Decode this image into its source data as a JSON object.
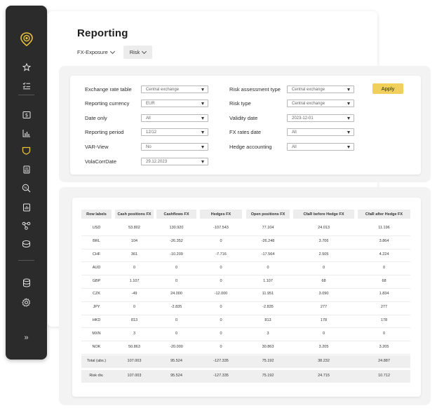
{
  "sidebar": {
    "logo_icon": "location-pin-icon",
    "items": [
      {
        "name": "star-icon"
      },
      {
        "name": "checklist-icon"
      },
      {
        "name": "dollar-document-icon"
      },
      {
        "name": "bar-chart-icon"
      },
      {
        "name": "shield-icon",
        "active": true
      },
      {
        "name": "document-icon"
      },
      {
        "name": "percent-search-icon"
      },
      {
        "name": "report-icon"
      },
      {
        "name": "flow-icon"
      },
      {
        "name": "coins-icon"
      },
      {
        "name": "database-icon"
      },
      {
        "name": "settings-icon"
      },
      {
        "name": "expand-icon",
        "label": "»"
      }
    ],
    "accent": "#e8c23a"
  },
  "page": {
    "title": "Reporting",
    "tabs": [
      {
        "label": "FX-Exposure"
      },
      {
        "label": "Risk",
        "active": true
      }
    ]
  },
  "filters": {
    "left": [
      {
        "label": "Exchange rate table",
        "value": "Central exchange"
      },
      {
        "label": "Reporting currency",
        "value": "EUR"
      },
      {
        "label": "Date only",
        "value": "All"
      },
      {
        "label": "Reporting period",
        "value": "12/12"
      },
      {
        "label": "VAR-View",
        "value": "No"
      },
      {
        "label": "VolaCorrDate",
        "value": "29.12.2023"
      }
    ],
    "right": [
      {
        "label": "Risk assessment type",
        "value": "Central exchange"
      },
      {
        "label": "Risk type",
        "value": "Central exchange"
      },
      {
        "label": "Validity date",
        "value": "2023-12-01"
      },
      {
        "label": "FX rates date",
        "value": "All"
      },
      {
        "label": "Hedge accounting",
        "value": "All"
      }
    ],
    "apply_label": "Apply",
    "apply_color": "#f0cf5a"
  },
  "table": {
    "headers": [
      "Row labels",
      "Cash positions FX",
      "Cashflows FX",
      "Hedges FX",
      "Open positions FX",
      "CfaR before Hedge FX",
      "CfaR after Hedge FX"
    ],
    "rows": [
      [
        "USD",
        "53.802",
        "130.920",
        "-107.543",
        "77.104",
        "24.013",
        "11.196"
      ],
      [
        "BRL",
        "104",
        "-26.352",
        "0",
        "-26.248",
        "3.706",
        "3.864"
      ],
      [
        "CHF",
        "361",
        "-10.209",
        "-7.716",
        "-17.564",
        "2.505",
        "4.224"
      ],
      [
        "AUD",
        "0",
        "0",
        "0",
        "0",
        "0",
        "0"
      ],
      [
        "GBP",
        "1.107",
        "0",
        "0",
        "1.107",
        "68",
        "68"
      ],
      [
        "CZK",
        "-49",
        "24.000",
        "-12.000",
        "11.951",
        "3.090",
        "1.834"
      ],
      [
        "JPY",
        "0",
        "-2.835",
        "0",
        "-2.835",
        "277",
        "277"
      ],
      [
        "HKD",
        "813",
        "0",
        "0",
        "813",
        "178",
        "178"
      ],
      [
        "MXN",
        "3",
        "0",
        "0",
        "3",
        "0",
        "0"
      ],
      [
        "NOK",
        "50.863",
        "-20.000",
        "0",
        "30.863",
        "3.205",
        "3.205"
      ]
    ],
    "totals": [
      [
        "Total (abs.)",
        "107.003",
        "95.524",
        "-127.335",
        "75.192",
        "38.232",
        "24.887"
      ],
      [
        "Risk div.",
        "107.003",
        "95.524",
        "-127.335",
        "75.192",
        "24.715",
        "10.712"
      ]
    ]
  }
}
